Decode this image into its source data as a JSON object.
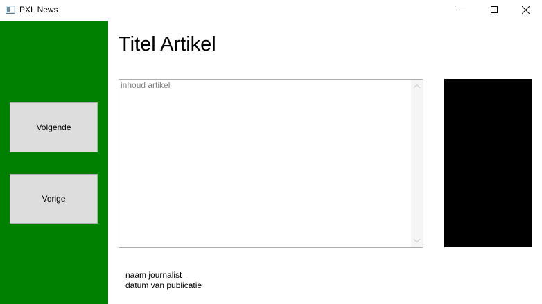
{
  "window": {
    "title": "PXL News"
  },
  "sidebar": {
    "next_label": "Volgende",
    "prev_label": "Vorige",
    "color": "#008000"
  },
  "article": {
    "title": "Titel Artikel",
    "content_placeholder": "inhoud artikel",
    "author": "naam journalist",
    "date": "datum van publicatie"
  },
  "image": {
    "color": "#000000"
  }
}
